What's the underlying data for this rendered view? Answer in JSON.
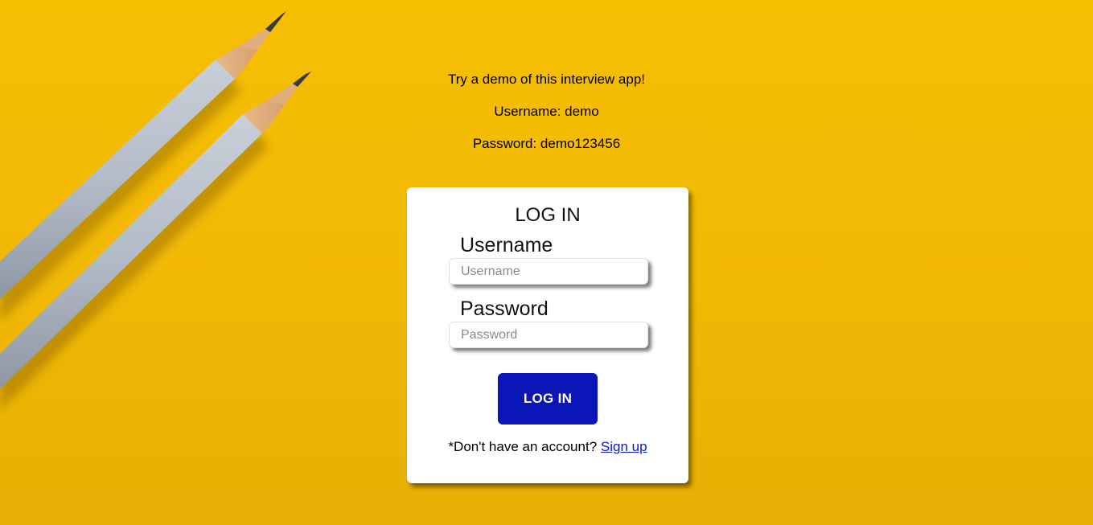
{
  "demo_info": {
    "intro": "Try a demo of this interview app!",
    "username_hint": "Username: demo",
    "password_hint": "Password: demo123456"
  },
  "login_card": {
    "title": "LOG IN",
    "username_label": "Username",
    "username_placeholder": "Username",
    "username_value": "",
    "password_label": "Password",
    "password_placeholder": "Password",
    "password_value": "",
    "submit_label": "LOG IN",
    "signup_prompt": "*Don't have an account?",
    "signup_link": "Sign up"
  },
  "colors": {
    "background": "#f4bc03",
    "button": "#0a16b8",
    "link": "#0a16d8"
  },
  "icons": [
    "pencil-illustration"
  ]
}
